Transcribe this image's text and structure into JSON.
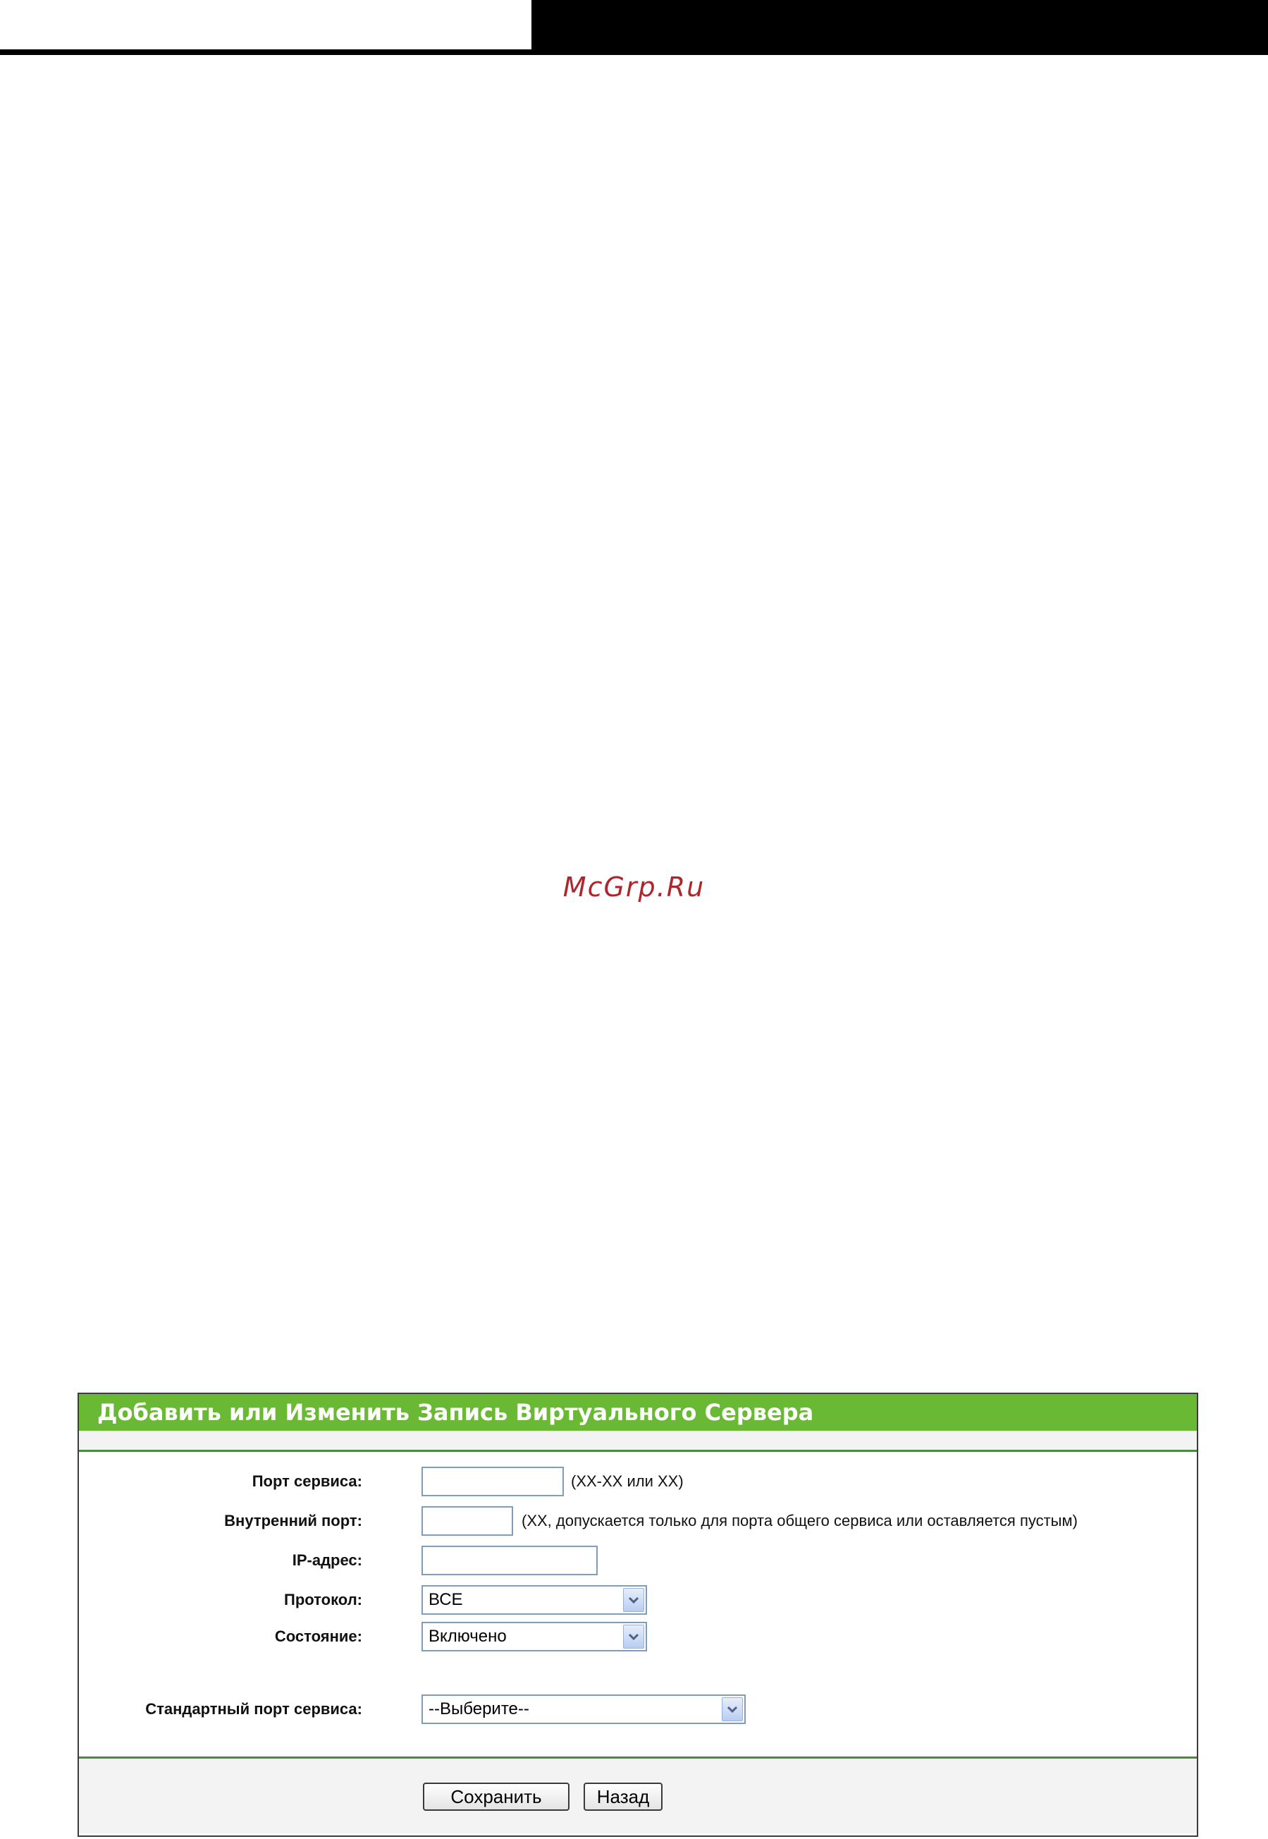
{
  "watermark": {
    "text": "McGrp.Ru"
  },
  "panel": {
    "title": "Добавить или Изменить Запись Виртуального Сервера",
    "fields": {
      "service_port": {
        "label": "Порт сервиса:",
        "value": "",
        "hint": "(XX-XX или XX)"
      },
      "internal_port": {
        "label": "Внутренний порт:",
        "value": "",
        "hint": "(XX, допускается только для порта общего сервиса или оставляется пустым)"
      },
      "ip_address": {
        "label": "IP-адрес:",
        "value": ""
      },
      "protocol": {
        "label": "Протокол:",
        "selected": "ВСЕ"
      },
      "status": {
        "label": "Состояние:",
        "selected": "Включено"
      },
      "common_service_port": {
        "label": "Стандартный порт сервиса:",
        "selected": "--Выберите--"
      }
    },
    "buttons": {
      "save": "Сохранить",
      "back": "Назад"
    }
  },
  "colors": {
    "title_bar": "#6ab934",
    "divider": "#4c8a3c",
    "watermark": "#b0252c",
    "field_border": "#7f9db9"
  },
  "icons": {
    "dropdown": "chevron-down-icon"
  }
}
